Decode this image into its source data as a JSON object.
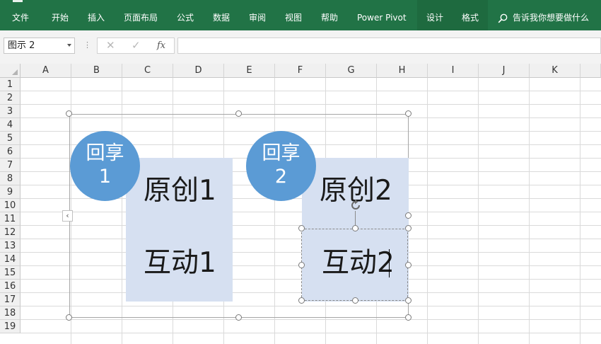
{
  "ribbon": {
    "tabs": [
      {
        "label": "文件"
      },
      {
        "label": "开始"
      },
      {
        "label": "插入"
      },
      {
        "label": "页面布局"
      },
      {
        "label": "公式"
      },
      {
        "label": "数据"
      },
      {
        "label": "审阅"
      },
      {
        "label": "视图"
      },
      {
        "label": "帮助"
      },
      {
        "label": "Power Pivot"
      },
      {
        "label": "设计"
      },
      {
        "label": "格式"
      }
    ],
    "tell_me": "告诉我你想要做什么"
  },
  "formula_bar": {
    "name_box": "图示 2",
    "cancel_glyph": "✕",
    "enter_glyph": "✓",
    "fx_label": "fx",
    "formula": ""
  },
  "grid": {
    "columns": [
      "A",
      "B",
      "C",
      "D",
      "E",
      "F",
      "G",
      "H",
      "I",
      "J",
      "K"
    ],
    "rows": [
      "1",
      "2",
      "3",
      "4",
      "5",
      "6",
      "7",
      "8",
      "9",
      "10",
      "11",
      "12",
      "13",
      "14",
      "15",
      "16",
      "17",
      "18",
      "19"
    ]
  },
  "diagram": {
    "circle1": {
      "line1": "回享",
      "line2": "1"
    },
    "circle2": {
      "line1": "回享",
      "line2": "2"
    },
    "box1": {
      "top": "原创1",
      "bottom": "互动1"
    },
    "box2": {
      "top": "原创2",
      "bottom": "互动2"
    },
    "colors": {
      "circle": "#5b9bd5",
      "box": "#d6e0f1",
      "ribbon": "#217346"
    }
  }
}
